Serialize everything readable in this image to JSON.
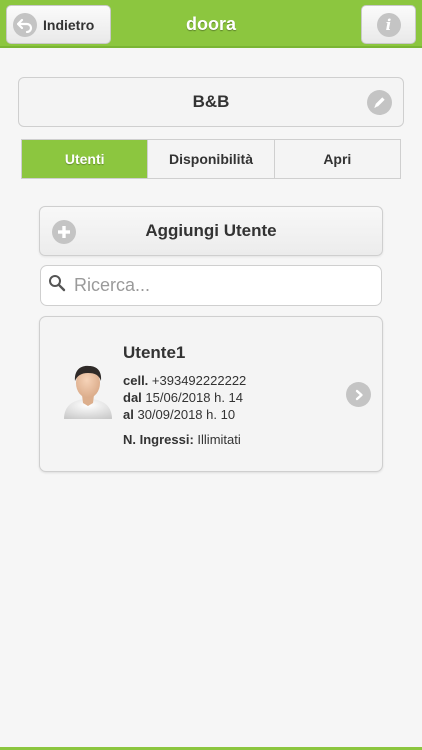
{
  "header": {
    "title": "doora",
    "back_label": "Indietro",
    "brand_color": "#8cc63f"
  },
  "property": {
    "name": "B&B"
  },
  "tabs": [
    {
      "label": "Utenti",
      "active": true
    },
    {
      "label": "Disponibilità",
      "active": false
    },
    {
      "label": "Apri",
      "active": false
    }
  ],
  "add_user": {
    "label": "Aggiungi Utente"
  },
  "search": {
    "placeholder": "Ricerca..."
  },
  "users": [
    {
      "name": "Utente1",
      "phone_label": "cell.",
      "phone": "+393492222222",
      "from_label": "dal",
      "from": "15/06/2018 h. 14",
      "to_label": "al",
      "to": "30/09/2018 h. 10",
      "entries_label": "N. Ingressi:",
      "entries": "Illimitati"
    }
  ],
  "icons": {
    "back": "back-arrow-icon",
    "info": "info-icon",
    "edit": "pencil-icon",
    "add": "plus-icon",
    "search": "search-icon",
    "open": "chevron-right-icon",
    "avatar": "user-avatar-icon"
  }
}
